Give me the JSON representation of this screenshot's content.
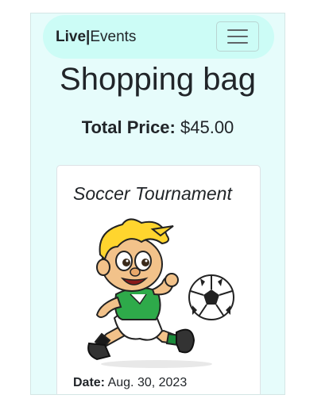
{
  "navbar": {
    "brand_bold": "Live|",
    "brand_rest": "Events",
    "menu_icon": "hamburger-icon"
  },
  "page": {
    "title": "Shopping bag",
    "total_label": "Total Price:",
    "total_value": "$45.00"
  },
  "cart": {
    "items": [
      {
        "title": "Soccer Tournament",
        "image": "soccer-player-cartoon",
        "date_label": "Date:",
        "date_value": "Aug. 30, 2023"
      }
    ]
  },
  "colors": {
    "page_bg": "#e6fcfb",
    "navbar_bg": "#ccfcf6",
    "text": "#212529"
  }
}
